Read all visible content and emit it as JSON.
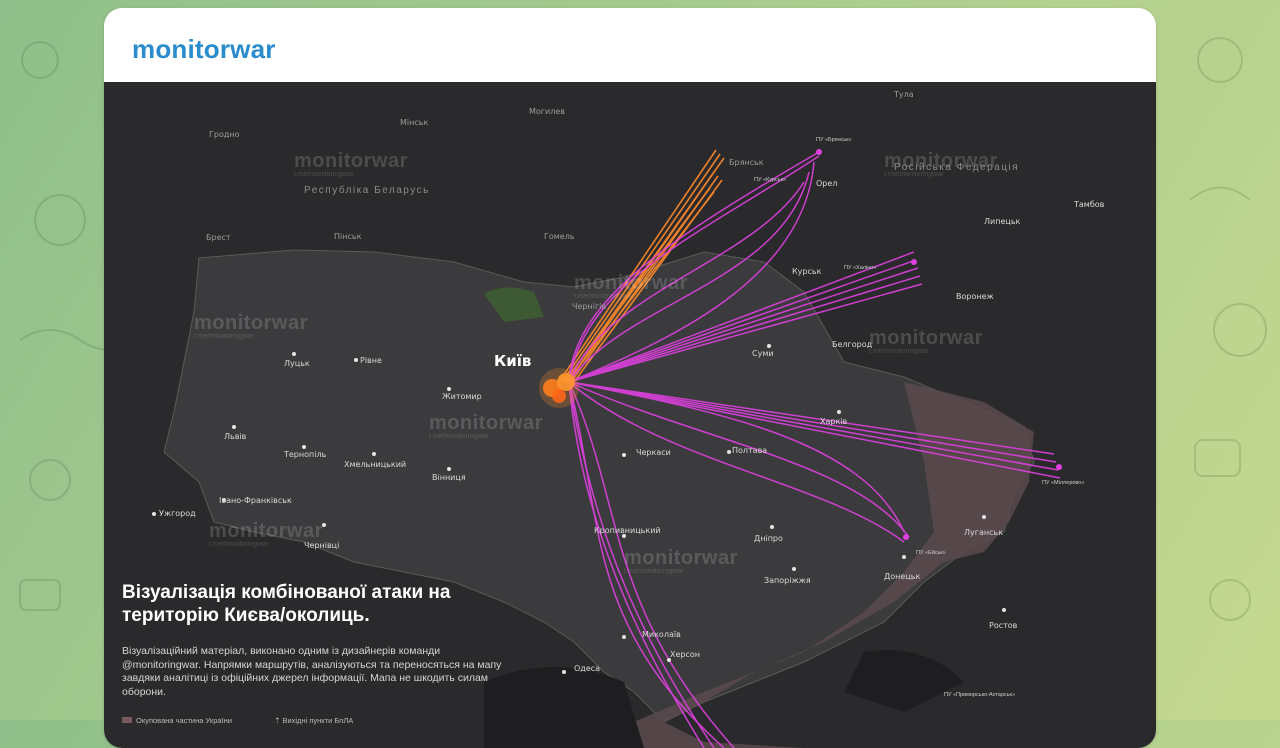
{
  "channel": {
    "name": "monitorwar"
  },
  "map": {
    "watermark": "monitorwar",
    "watermark_sub": "t.me/monitoringwar",
    "regions": [
      "Республіка Беларусь",
      "Російська Федерація"
    ],
    "cities": [
      {
        "name": "Київ",
        "cls": "kyiv"
      },
      {
        "name": "Луцьк"
      },
      {
        "name": "Рівне"
      },
      {
        "name": "Житомир"
      },
      {
        "name": "Львів"
      },
      {
        "name": "Тернопіль"
      },
      {
        "name": "Хмельницький"
      },
      {
        "name": "Вінниця"
      },
      {
        "name": "Івано-Франківськ"
      },
      {
        "name": "Ужгород"
      },
      {
        "name": "Чернівці"
      },
      {
        "name": "Черкаси"
      },
      {
        "name": "Полтава"
      },
      {
        "name": "Суми"
      },
      {
        "name": "Харків"
      },
      {
        "name": "Кропивницький"
      },
      {
        "name": "Дніпро"
      },
      {
        "name": "Запоріжжя"
      },
      {
        "name": "Миколаїв"
      },
      {
        "name": "Херсон"
      },
      {
        "name": "Одеса"
      },
      {
        "name": "Луганськ"
      },
      {
        "name": "Донецьк"
      },
      {
        "name": "Ростов"
      },
      {
        "name": "Орел"
      },
      {
        "name": "Курськ"
      },
      {
        "name": "Воронеж"
      },
      {
        "name": "Белгород"
      },
      {
        "name": "Липецьк"
      },
      {
        "name": "Тамбов"
      },
      {
        "name": "Брянськ"
      },
      {
        "name": "Гомель"
      },
      {
        "name": "Мінськ"
      },
      {
        "name": "Могилев"
      },
      {
        "name": "Гродно"
      },
      {
        "name": "Брест"
      },
      {
        "name": "Пінськ"
      },
      {
        "name": "Чернігів"
      },
      {
        "name": "Тула"
      }
    ],
    "routes": [
      "ПУ «Курськ»",
      "ПУ «Халіно»",
      "ПУ «Міллерово»",
      "ПУ «Ейськ»",
      "ПУ «Приморсько-Ахтарськ»",
      "ПУ «Брянськ»"
    ]
  },
  "caption": {
    "title": "Візуалізація комбінованої атаки на територію Києва/околиць.",
    "description": "Візуалізаційний матеріал, виконано одним із дизайнерів команди @monitoringwar. Напрямки маршрутів, аналізуються та переносяться на мапу завдяки аналітиці із офіційних джерел інформації. Мапа не шкодить силам оборони.",
    "legend": [
      "Окупована частина України",
      "Вихідні пункти БпЛА"
    ]
  },
  "colors": {
    "accent": "#2a8ccc",
    "route_shahed": "#e040e0",
    "route_missile": "#ff8a2a",
    "map_bg": "#2a2a2c"
  }
}
